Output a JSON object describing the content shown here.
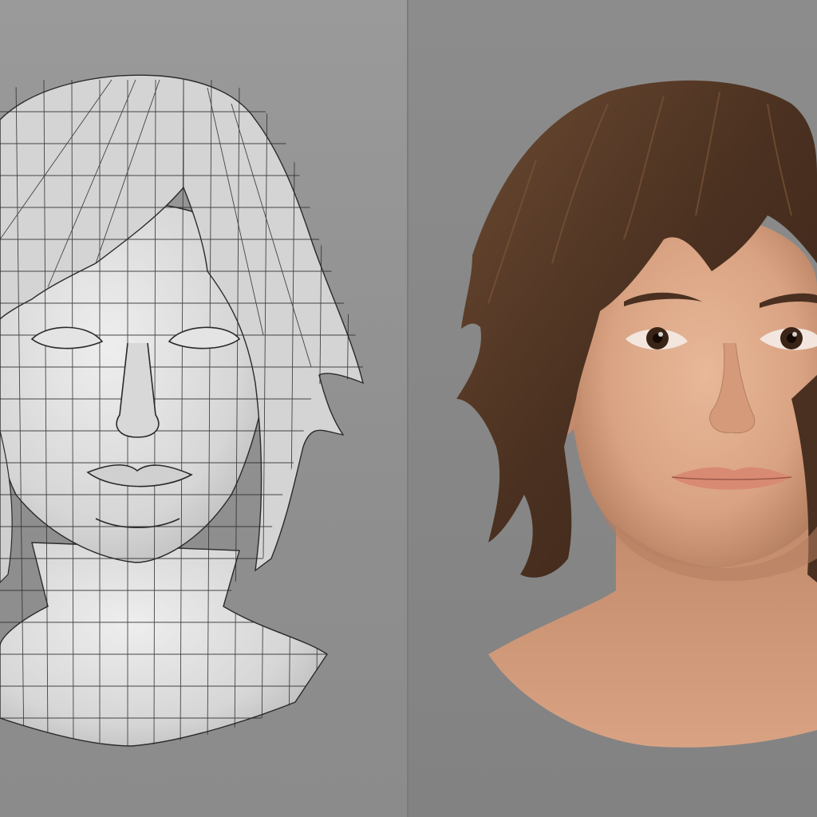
{
  "figure": {
    "left_panel": {
      "subject": "wireframe-head-render"
    },
    "right_panel": {
      "subject": "realistic-head-render"
    },
    "colors": {
      "background_left": "#959595",
      "background_right": "#878787",
      "wire_surface": "#dcdcdc",
      "wire_line": "#2a2a2a",
      "hair_brown": "#4a3020",
      "hair_highlight": "#7a5538",
      "skin": "#d9a383",
      "skin_shadow": "#b47e60",
      "lip": "#d98a72",
      "iris": "#3a2416"
    }
  }
}
